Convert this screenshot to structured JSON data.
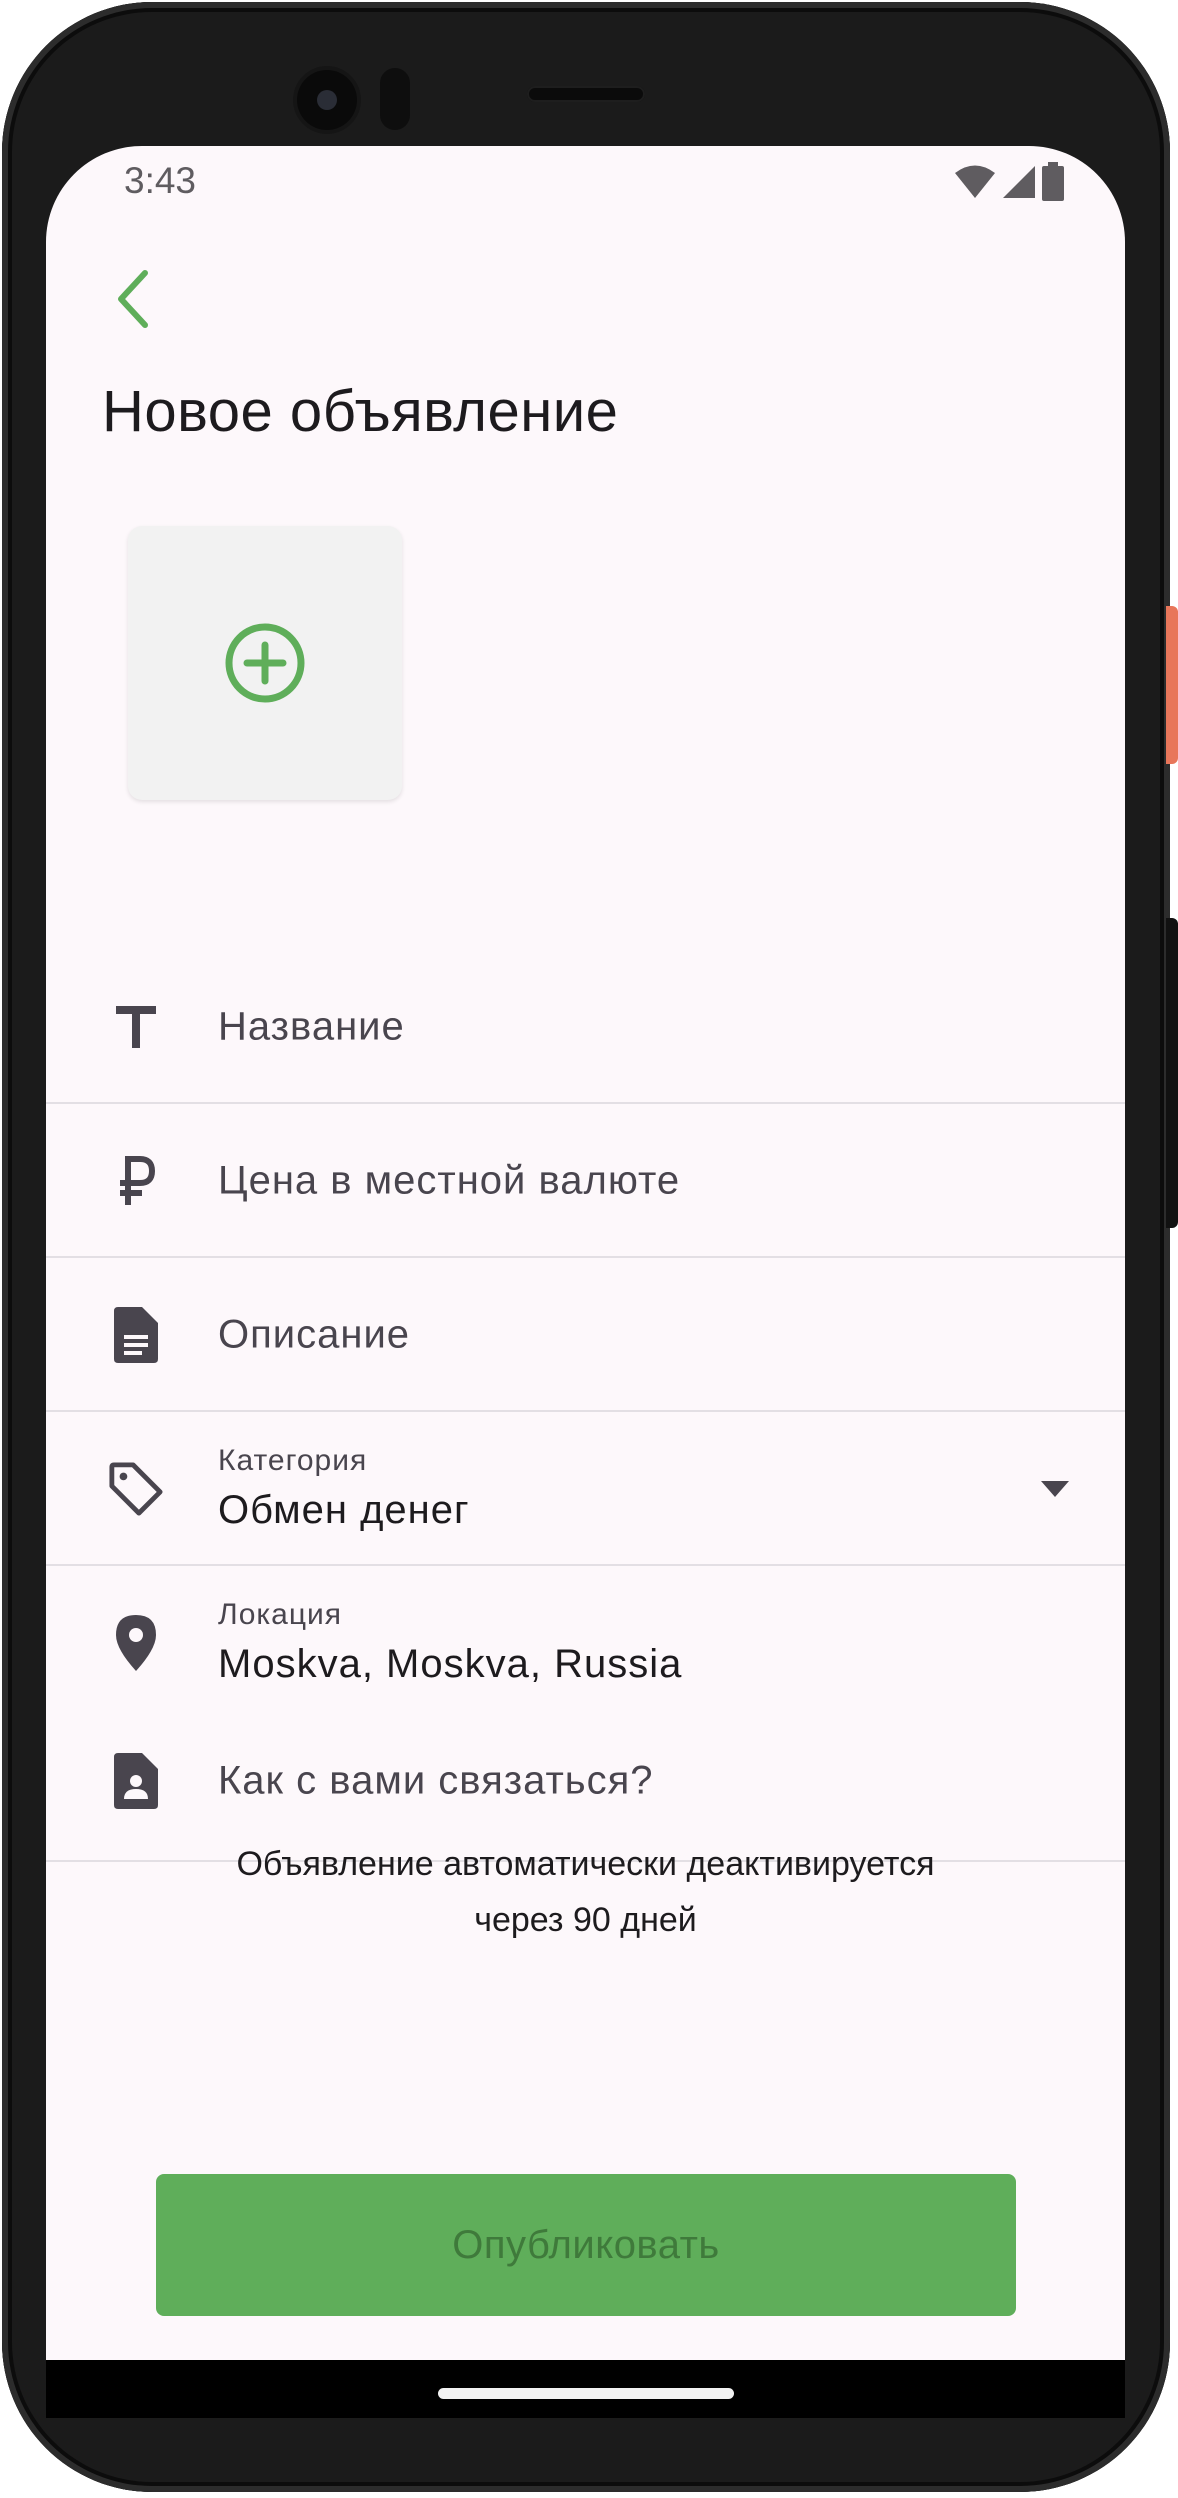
{
  "status_bar": {
    "time": "3:43",
    "icons": [
      "wifi-icon",
      "cell-signal-icon",
      "battery-icon"
    ]
  },
  "header": {
    "back_icon": "chevron-left-icon",
    "title": "Новое объявление"
  },
  "photo_add": {
    "icon": "add-circle-icon"
  },
  "form": {
    "title": {
      "icon": "text-icon",
      "placeholder": "Название"
    },
    "price": {
      "icon": "ruble-icon",
      "placeholder": "Цена в местной валюте"
    },
    "description": {
      "icon": "document-icon",
      "placeholder": "Описание"
    },
    "category": {
      "icon": "tag-icon",
      "label": "Категория",
      "value": "Обмен денег"
    },
    "location": {
      "icon": "location-pin-icon",
      "label": "Локация",
      "value": "Moskva, Moskva, Russia"
    },
    "contact": {
      "icon": "contact-card-icon",
      "placeholder": "Как с вами связаться?"
    }
  },
  "notice": {
    "line1": "Объявление автоматически деактивируется",
    "line2": "через 90 дней"
  },
  "publish_button": {
    "label": "Опубликовать"
  },
  "colors": {
    "accent": "#5fae5a",
    "background": "#fdf8fb",
    "icon_dark": "#49454e",
    "divider": "#e3dfe4"
  }
}
